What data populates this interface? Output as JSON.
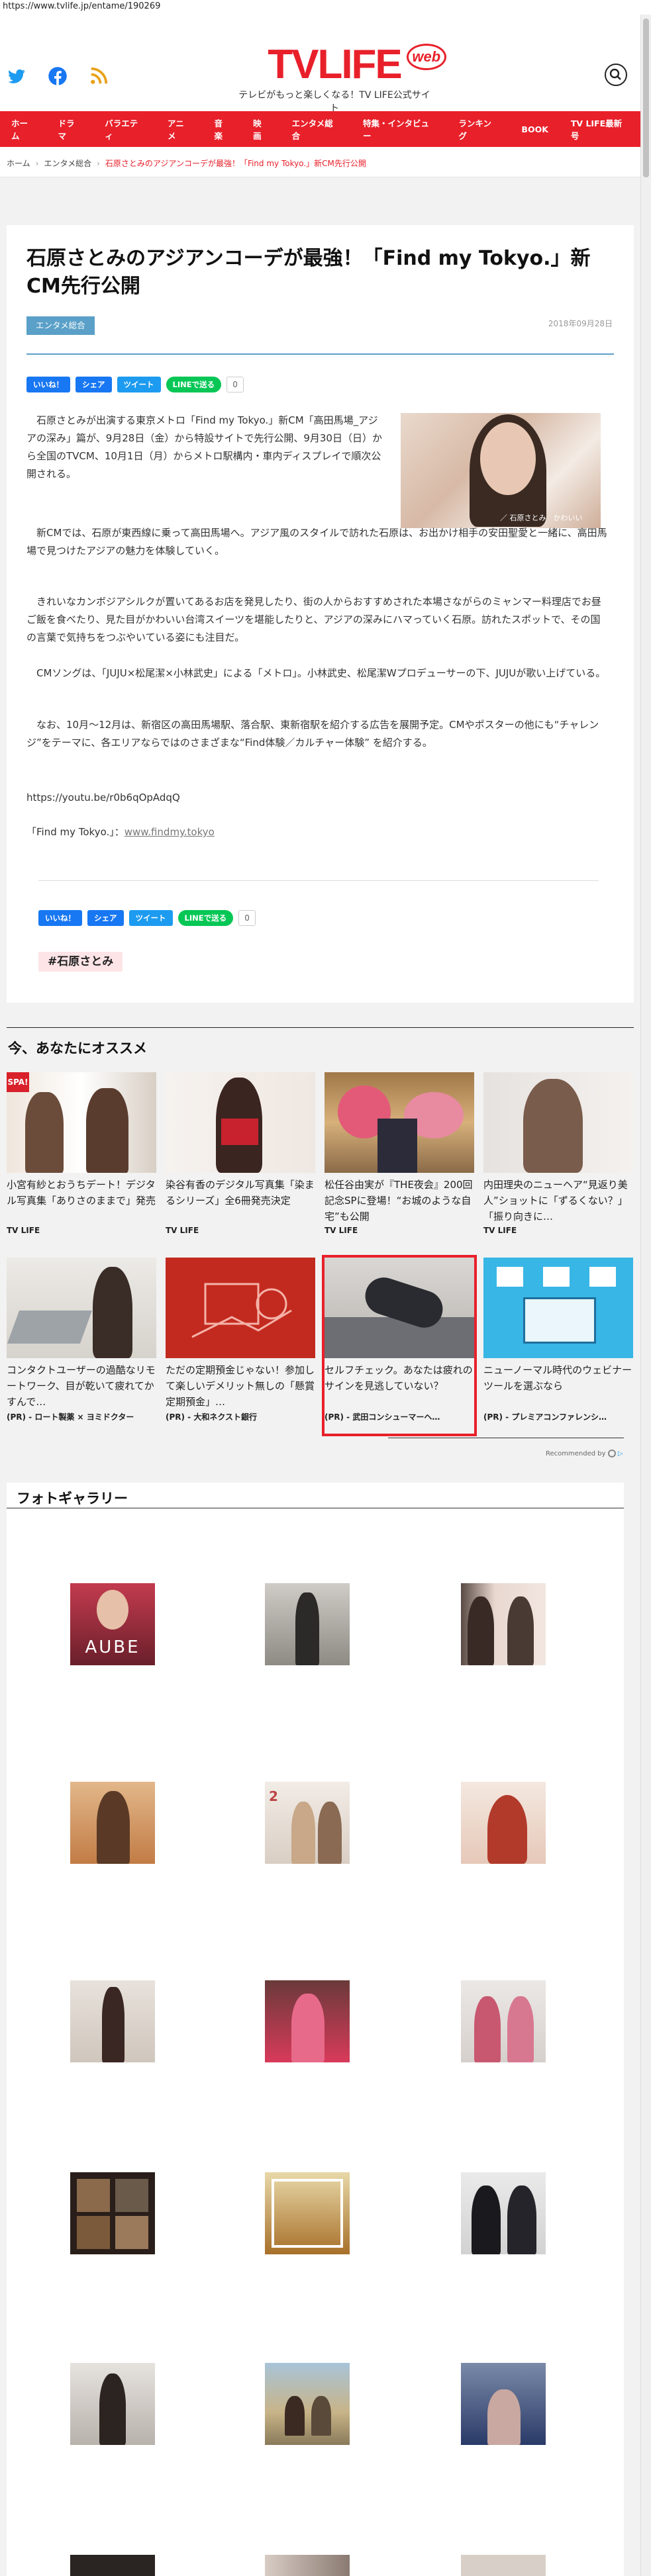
{
  "browser": {
    "url": "https://www.tvlife.jp/entame/190269"
  },
  "header": {
    "logo_text": "TVLIFE",
    "logo_badge": "web",
    "tagline": "テレビがもっと楽しくなる！TV LIFE公式サイト",
    "social": [
      "twitter-icon",
      "facebook-icon",
      "rss-icon"
    ]
  },
  "nav": [
    "ホーム",
    "ドラマ",
    "バラエティ",
    "アニメ",
    "音楽",
    "映画",
    "エンタメ総合",
    "特集・インタビュー",
    "ランキング",
    "BOOK",
    "TV LIFE最新号"
  ],
  "breadcrumb": {
    "home": "ホーム",
    "category": "エンタメ総合",
    "current": "石原さとみのアジアンコーデが最強！「Find my Tokyo.」新CM先行公開"
  },
  "article": {
    "title": "石原さとみのアジアンコーデが最強！「Find my Tokyo.」新CM先行公開",
    "category": "エンタメ総合",
    "date": "2018年09月28日",
    "photo_caption": "／ 石原さとみ　かわいい",
    "paragraphs": [
      "石原さとみが出演する東京メトロ「Find my Tokyo.」新CM「高田馬場_アジアの深み」篇が、9月28日（金）から特設サイトで先行公開、9月30日（日）から全国のTVCM、10月1日（月）からメトロ駅構内・車内ディスプレイで順次公開される。",
      "新CMでは、石原が東西線に乗って高田馬場へ。アジア風のスタイルで訪れた石原は、お出かけ相手の安田聖愛と一緒に、高田馬場で見つけたアジアの魅力を体験していく。",
      "きれいなカンボジアシルクが置いてあるお店を発見したり、街の人からおすすめされた本場さながらのミャンマー料理店でお昼ご飯を食べたり、見た目がかわいい台湾スイーツを堪能したりと、アジアの深みにハマっていく石原。訪れたスポットで、その国の言葉で気持ちをつぶやいている姿にも注目だ。",
      "CMソングは、「JUJU×松尾潔×小林武史」による「メトロ」。小林武史、松尾潔Wプロデューサーの下、JUJUが歌い上げている。",
      "なお、10月〜12月は、新宿区の高田馬場駅、落合駅、東新宿駅を紹介する広告を展開予定。CMやポスターの他にも“チャレンジ”をテーマに、各エリアならではのさまざまな“Find体験／カルチャー体験” を紹介する。"
    ],
    "youtube": "https://youtu.be/r0b6qOpAdqQ",
    "site_label": "「Find my Tokyo.」：",
    "site_link": "www.findmy.tokyo",
    "tag": "#石原さとみ"
  },
  "share": {
    "like": "いいね！",
    "share": "シェア",
    "tweet": "ツイート",
    "line": "LINEで送る",
    "count": "0"
  },
  "recommend": {
    "title": "今、あなたにオススメ",
    "items": [
      {
        "title": "小宮有紗とおうちデート！デジタル写真集「ありさのままで」発売",
        "source": "TV LIFE"
      },
      {
        "title": "染谷有香のデジタル写真集「染まるシリーズ」全6冊発売決定",
        "source": "TV LIFE"
      },
      {
        "title": "松任谷由実が『THE夜会』200回記念SPに登場！“お城のような自宅”も公開",
        "source": "TV LIFE"
      },
      {
        "title": "内田理央のニューヘア“見返り美人”ショットに「ずるくない？」「振り向きに…",
        "source": "TV LIFE"
      },
      {
        "title": "コンタクトユーザーの過酷なリモートワーク、目が乾いて疲れてかすんで…",
        "source": "(PR) - ロート製薬 × ヨミドクター"
      },
      {
        "title": "ただの定期預金じゃない！参加して楽しいデメリット無しの「懸賞定期預金」…",
        "source": "(PR) - 大和ネクスト銀行"
      },
      {
        "title": "セルフチェック。あなたは疲れのサインを見逃していない？",
        "source": "(PR) - 武田コンシューマーヘ…"
      },
      {
        "title": "ニューノーマル時代のウェビナーツールを選ぶなら",
        "source": "(PR) - プレミアコンファレンシ…"
      }
    ],
    "recommended_by": "Recommended by"
  },
  "gallery": {
    "title": "フォトギャラリー",
    "first_thumb_text": "AUBE"
  }
}
